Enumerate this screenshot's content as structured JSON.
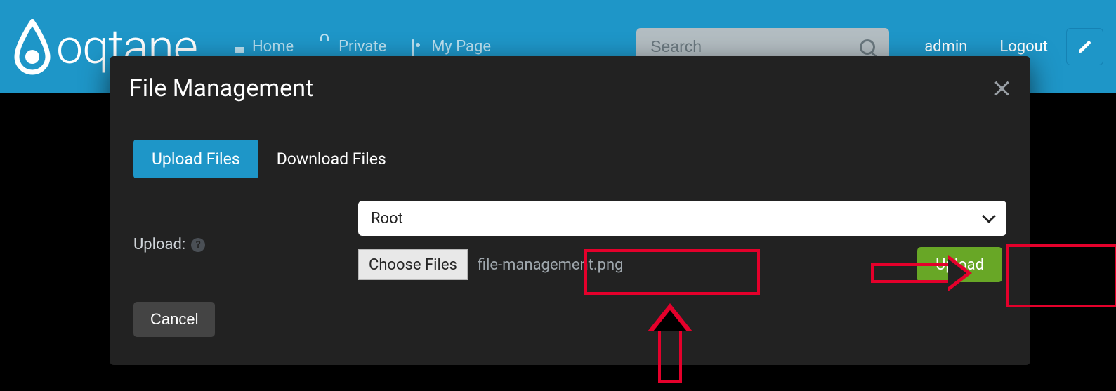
{
  "brand": {
    "name": "oqtane"
  },
  "nav": {
    "home": "Home",
    "private": "Private",
    "mypage": "My Page"
  },
  "search": {
    "placeholder": "Search"
  },
  "user": {
    "name": "admin",
    "logout": "Logout"
  },
  "modal": {
    "title": "File Management",
    "tabs": {
      "upload": "Upload Files",
      "download": "Download Files"
    },
    "upload_label": "Upload:",
    "folder_selected": "Root",
    "choose_files_label": "Choose Files",
    "selected_file": "file-management.png",
    "upload_button": "Upload",
    "cancel_button": "Cancel",
    "help_tooltip": "?"
  }
}
